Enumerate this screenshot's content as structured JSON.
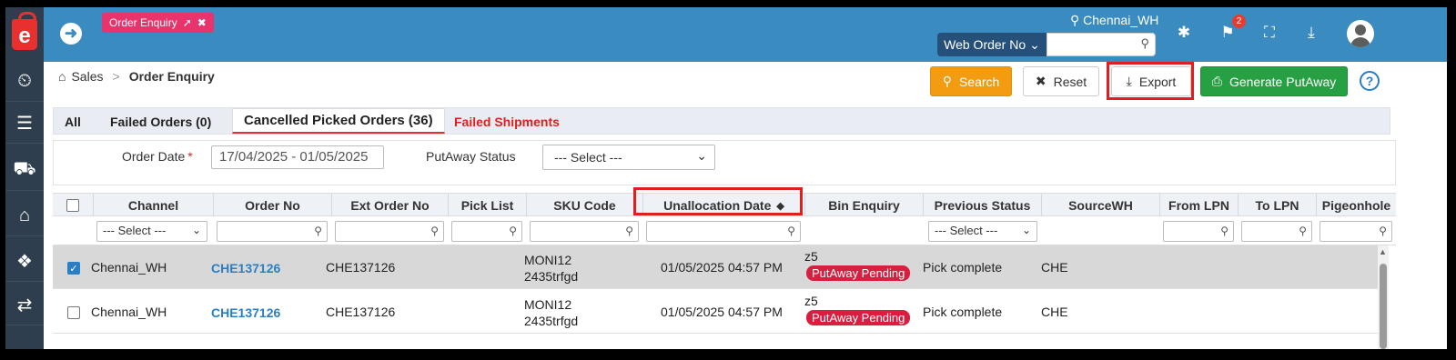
{
  "sidebar": {
    "logo_letter": "e",
    "items": [
      {
        "icon": "dashboard-icon",
        "glyph": "⏲"
      },
      {
        "icon": "list-indent-icon",
        "glyph": "☰"
      },
      {
        "icon": "cart-icon",
        "glyph": "⛟"
      },
      {
        "icon": "briefcase-icon",
        "glyph": "⌂"
      },
      {
        "icon": "cubes-icon",
        "glyph": "❖"
      },
      {
        "icon": "exchange-icon",
        "glyph": "⇄"
      }
    ]
  },
  "header": {
    "page_pill": "Order Enquiry",
    "warehouse": "Chennai_WH",
    "order_type_select": "Web Order No",
    "order_search_value": "",
    "notification_count": "2"
  },
  "breadcrumb": {
    "root": "Sales",
    "current": "Order Enquiry"
  },
  "actions": {
    "search": "Search",
    "reset": "Reset",
    "export": "Export",
    "generate_putaway": "Generate PutAway",
    "help": "?"
  },
  "tabs": [
    {
      "label": "All"
    },
    {
      "label": "Failed Orders (0)"
    },
    {
      "label": "Cancelled Picked Orders (36)",
      "active": true
    },
    {
      "label": "Failed Shipments"
    }
  ],
  "filters": {
    "order_date_label": "Order Date",
    "required_mark": "*",
    "order_date_value": "17/04/2025 - 01/05/2025",
    "putaway_status_label": "PutAway Status",
    "putaway_status_value": "--- Select ---"
  },
  "table": {
    "columns": [
      "Channel",
      "Order No",
      "Ext Order No",
      "Pick List",
      "SKU Code",
      "Unallocation Date",
      "Bin Enquiry",
      "Previous Status",
      "SourceWH",
      "From LPN",
      "To LPN",
      "Pigeonhole"
    ],
    "filter_row": {
      "channel_select": "--- Select ---",
      "previous_status_select": "--- Select ---"
    },
    "rows": [
      {
        "selected": true,
        "channel": "Chennai_WH",
        "order_no": "CHE137126",
        "ext_order_no": "CHE137126",
        "pick_list": "",
        "sku_line1": "MONI12",
        "sku_line2": "2435trfgd",
        "unallocation_date": "01/05/2025 04:57 PM",
        "bin": "z5",
        "status_badge": "PutAway Pending",
        "previous_status": "Pick complete",
        "source_wh": "CHE"
      },
      {
        "selected": false,
        "channel": "Chennai_WH",
        "order_no": "CHE137126",
        "ext_order_no": "CHE137126",
        "pick_list": "",
        "sku_line1": "MONI12",
        "sku_line2": "2435trfgd",
        "unallocation_date": "01/05/2025 04:57 PM",
        "bin": "z5",
        "status_badge": "PutAway Pending",
        "previous_status": "Pick complete",
        "source_wh": "CHE"
      }
    ]
  },
  "colors": {
    "header_blue": "#3a8bc0",
    "sidebar": "#2f3e4e",
    "search_orange": "#f39c12",
    "generate_green": "#27a043",
    "badge_red": "#d91f3f",
    "highlight_red": "#e01e1e",
    "link_blue": "#2a7fc4"
  }
}
